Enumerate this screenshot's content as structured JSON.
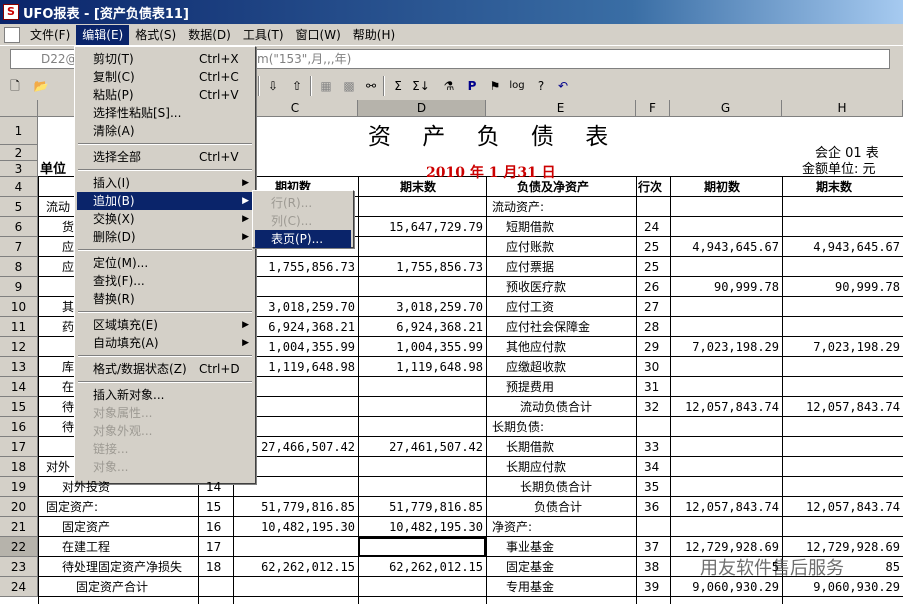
{
  "window": {
    "title": "UFO报表 - [资产负债表11]"
  },
  "menubar": [
    "文件(F)",
    "编辑(E)",
    "格式(S)",
    "数据(D)",
    "工具(T)",
    "窗口(W)",
    "帮助(H)"
  ],
  "formula": {
    "namebox": "D22@",
    "content": "m(\"153\",月,,,年)"
  },
  "toolbar": [
    "Σ",
    "Σ↓",
    "P",
    "log",
    "?",
    "↶"
  ],
  "columns": [
    "C",
    "D",
    "E",
    "F",
    "G",
    "H"
  ],
  "rows": [
    "1",
    "2",
    "3",
    "4",
    "5",
    "6",
    "7",
    "8",
    "9",
    "10",
    "11",
    "12",
    "13",
    "14",
    "15",
    "16",
    "17",
    "18",
    "19",
    "20",
    "21",
    "22",
    "23",
    "24"
  ],
  "report": {
    "title": "资 产 负 债 表",
    "form_code": "会企 01 表",
    "unit_label": "单位",
    "currency_label": "金额单位: 元",
    "date": "2010 年 1 月31 日"
  },
  "headers": {
    "c": "期初数",
    "d": "期末数",
    "e": "负债及净资产",
    "f": "行次",
    "g": "期初数",
    "h": "期末数"
  },
  "left_fragments": [
    "流动",
    "货",
    "应",
    "应",
    "其",
    "药",
    "库",
    "在",
    "待",
    "待",
    "对外",
    "对外投资",
    "固定资产:",
    "固定资产",
    "在建工程",
    "待处理固定资产净损失",
    "固定资产合计"
  ],
  "left_rows": [
    {
      "b": "14",
      "c": "",
      "d": ""
    },
    {
      "b": "15",
      "c": "51,779,816.85",
      "d": "51,779,816.85"
    },
    {
      "b": "16",
      "c": "10,482,195.30",
      "d": "10,482,195.30"
    },
    {
      "b": "17",
      "c": "",
      "d": ""
    },
    {
      "b": "18",
      "c": "62,262,012.15",
      "d": "62,262,012.15"
    }
  ],
  "cd_values": [
    {
      "c": "",
      "d": "15,647,729.79"
    },
    {
      "c": "1,755,856.73",
      "d": "1,755,856.73"
    },
    {
      "c": "3,018,259.70",
      "d": "3,018,259.70"
    },
    {
      "c": "6,924,368.21",
      "d": "6,924,368.21"
    },
    {
      "c": "1,004,355.99",
      "d": "1,004,355.99"
    },
    {
      "c": "1,119,648.98",
      "d": "1,119,648.98"
    },
    {
      "c": "27,466,507.42",
      "d": "27,461,507.42"
    }
  ],
  "right_rows": [
    {
      "e": "流动资产:",
      "f": "",
      "g": "",
      "h": ""
    },
    {
      "e": "短期借款",
      "f": "24",
      "g": "",
      "h": ""
    },
    {
      "e": "应付账款",
      "f": "25",
      "g": "4,943,645.67",
      "h": "4,943,645.67"
    },
    {
      "e": "应付票据",
      "f": "25",
      "g": "",
      "h": ""
    },
    {
      "e": "预收医疗款",
      "f": "26",
      "g": "90,999.78",
      "h": "90,999.78"
    },
    {
      "e": "应付工资",
      "f": "27",
      "g": "",
      "h": ""
    },
    {
      "e": "应付社会保障金",
      "f": "28",
      "g": "",
      "h": ""
    },
    {
      "e": "其他应付款",
      "f": "29",
      "g": "7,023,198.29",
      "h": "7,023,198.29"
    },
    {
      "e": "应缴超收款",
      "f": "30",
      "g": "",
      "h": ""
    },
    {
      "e": "预提费用",
      "f": "31",
      "g": "",
      "h": ""
    },
    {
      "e": "流动负债合计",
      "f": "32",
      "g": "12,057,843.74",
      "h": "12,057,843.74"
    },
    {
      "e": "长期负债:",
      "f": "",
      "g": "",
      "h": ""
    },
    {
      "e": "长期借款",
      "f": "33",
      "g": "",
      "h": ""
    },
    {
      "e": "长期应付款",
      "f": "34",
      "g": "",
      "h": ""
    },
    {
      "e": "长期负债合计",
      "f": "35",
      "g": "",
      "h": ""
    },
    {
      "e": "负债合计",
      "f": "36",
      "g": "12,057,843.74",
      "h": "12,057,843.74"
    },
    {
      "e": "净资产:",
      "f": "",
      "g": "",
      "h": ""
    },
    {
      "e": "事业基金",
      "f": "37",
      "g": "12,729,928.69",
      "h": "12,729,928.69"
    },
    {
      "e": "固定基金",
      "f": "38",
      "g": "5",
      "h": "85"
    },
    {
      "e": "专用基金",
      "f": "39",
      "g": "9,060,930.29",
      "h": "9,060,930.29"
    }
  ],
  "edit_menu": [
    {
      "label": "剪切(T)",
      "shortcut": "Ctrl+X"
    },
    {
      "label": "复制(C)",
      "shortcut": "Ctrl+C"
    },
    {
      "label": "粘贴(P)",
      "shortcut": "Ctrl+V"
    },
    {
      "label": "选择性粘贴[S]...",
      "shortcut": ""
    },
    {
      "label": "清除(A)",
      "shortcut": ""
    },
    {
      "label": "选择全部",
      "shortcut": "Ctrl+V"
    },
    {
      "label": "插入(I)",
      "shortcut": ""
    },
    {
      "label": "追加(B)",
      "shortcut": ""
    },
    {
      "label": "交换(X)",
      "shortcut": ""
    },
    {
      "label": "删除(D)",
      "shortcut": ""
    },
    {
      "label": "定位(M)...",
      "shortcut": ""
    },
    {
      "label": "查找(F)...",
      "shortcut": ""
    },
    {
      "label": "替换(R)",
      "shortcut": ""
    },
    {
      "label": "区域填充(E)",
      "shortcut": ""
    },
    {
      "label": "自动填充(A)",
      "shortcut": ""
    },
    {
      "label": "格式/数据状态(Z)",
      "shortcut": "Ctrl+D"
    },
    {
      "label": "插入新对象...",
      "shortcut": ""
    },
    {
      "label": "对象属性...",
      "shortcut": ""
    },
    {
      "label": "对象外观...",
      "shortcut": ""
    },
    {
      "label": "链接...",
      "shortcut": ""
    },
    {
      "label": "对象...",
      "shortcut": ""
    }
  ],
  "submenu": [
    {
      "label": "行(R)..."
    },
    {
      "label": "列(C)..."
    },
    {
      "label": "表页(P)..."
    }
  ],
  "watermark": "用友软件售后服务"
}
